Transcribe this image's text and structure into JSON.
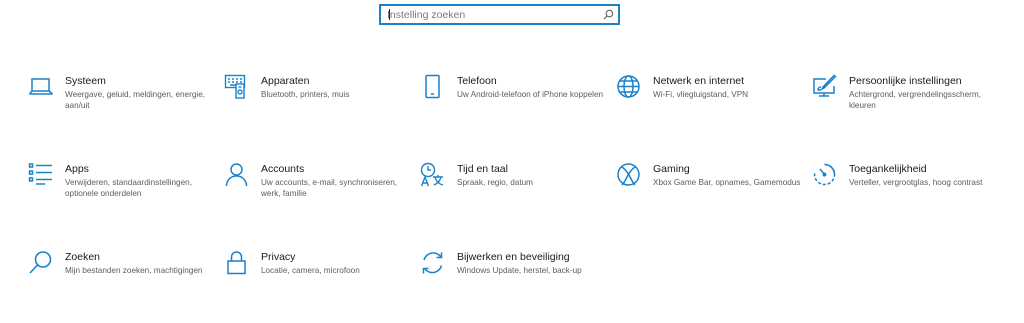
{
  "search": {
    "placeholder": "Instelling zoeken",
    "value": ""
  },
  "accent_color": "#1a82c9",
  "tiles": [
    {
      "icon": "laptop-icon",
      "title": "Systeem",
      "description": "Weergave, geluid, meldingen, energie, aan/uit"
    },
    {
      "icon": "devices-icon",
      "title": "Apparaten",
      "description": "Bluetooth, printers, muis"
    },
    {
      "icon": "phone-icon",
      "title": "Telefoon",
      "description": "Uw Android-telefoon of iPhone koppelen"
    },
    {
      "icon": "globe-icon",
      "title": "Netwerk en internet",
      "description": "Wi-Fi, vliegtuigstand, VPN"
    },
    {
      "icon": "personalization-icon",
      "title": "Persoonlijke instellingen",
      "description": "Achtergrond, vergrendelingsscherm, kleuren"
    },
    {
      "icon": "apps-list-icon",
      "title": "Apps",
      "description": "Verwijderen, standaardinstellingen, optionele onderdelen"
    },
    {
      "icon": "person-icon",
      "title": "Accounts",
      "description": "Uw accounts, e-mail, synchroniseren, werk, familie"
    },
    {
      "icon": "time-language-icon",
      "title": "Tijd en taal",
      "description": "Spraak, regio, datum"
    },
    {
      "icon": "xbox-icon",
      "title": "Gaming",
      "description": "Xbox Game Bar, opnames, Gamemodus"
    },
    {
      "icon": "accessibility-timer-icon",
      "title": "Toegankelijkheid",
      "description": "Verteller, vergrootglas, hoog contrast"
    },
    {
      "icon": "search-magnifier-icon",
      "title": "Zoeken",
      "description": "Mijn bestanden zoeken, machtigingen"
    },
    {
      "icon": "lock-icon",
      "title": "Privacy",
      "description": "Locatie, camera, microfoon"
    },
    {
      "icon": "update-sync-icon",
      "title": "Bijwerken en beveiliging",
      "description": "Windows Update, herstel, back-up"
    }
  ]
}
